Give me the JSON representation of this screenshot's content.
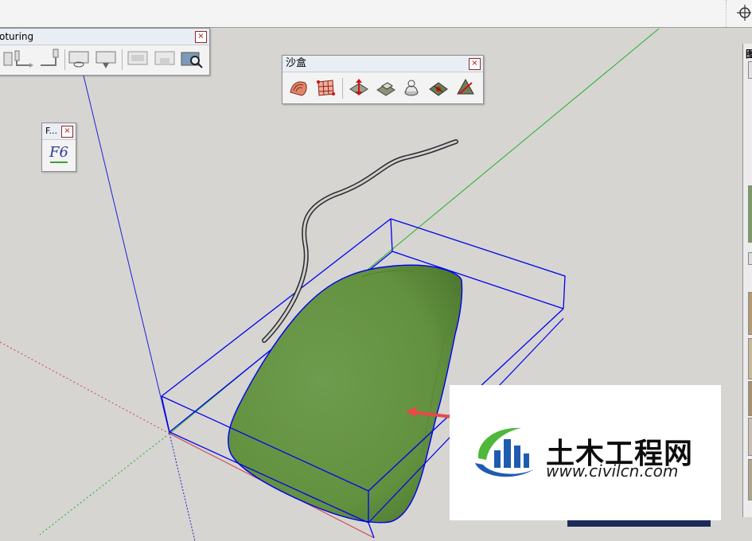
{
  "toolbars": {
    "sandbox": {
      "title": "沙盒",
      "close": "×",
      "tools": [
        "from-contours-icon",
        "from-scratch-icon",
        "smoove-icon",
        "stamp-icon",
        "drape-icon",
        "add-detail-icon",
        "flip-edge-icon"
      ]
    },
    "contouring": {
      "title": "oturing",
      "close": "×"
    },
    "font": {
      "title": "F...",
      "close": "×",
      "glyph": "F6"
    }
  },
  "right_panel": {
    "title": "图"
  },
  "watermark": {
    "text_zh": "土木工程网",
    "url": "www.civilcn.com"
  },
  "colors": {
    "terrain": "#6b9a4c",
    "bounding_box": "#0000ee",
    "green_axis": "#20b020",
    "blue_axis": "#2020d0",
    "red_axis": "#d04040",
    "arrow": "#e84848",
    "navy": "#1c2a5a"
  }
}
